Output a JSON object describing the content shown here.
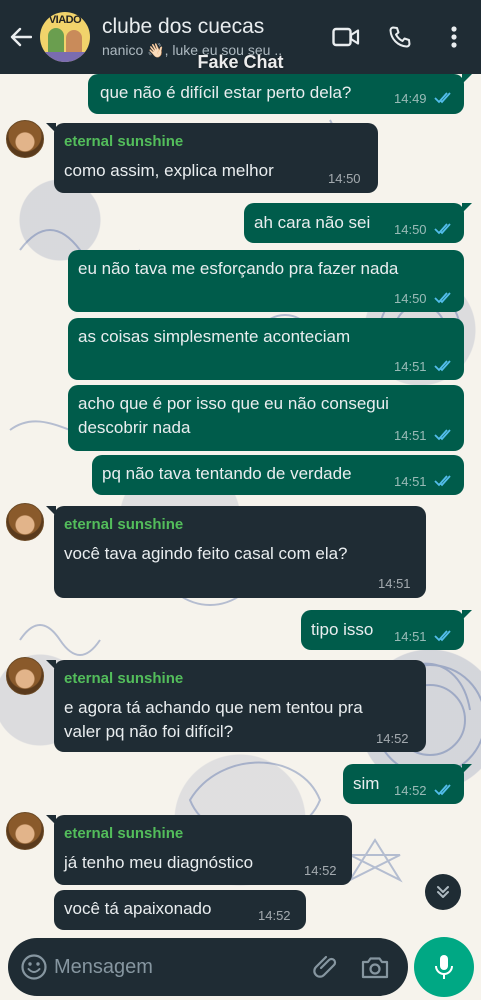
{
  "header": {
    "avatar_text": "VIADO",
    "title": "clube dos cuecas",
    "members": "nanico 👋🏻, luke eu sou seu .."
  },
  "watermark": "Fake Chat",
  "colors": {
    "header_bg": "#1f2c34",
    "outgoing_bubble": "#005c4b",
    "incoming_bubble": "#1f2c34",
    "sender_name": "#53bd5b",
    "read_ticks": "#53bdeb",
    "mic_button": "#00a884"
  },
  "icons": {
    "back": "arrow-left",
    "video": "video-camera",
    "call": "phone",
    "menu": "vertical-dots",
    "emoji": "smiley",
    "attach": "paperclip",
    "camera": "camera",
    "mic": "microphone",
    "scroll": "double-chevron-down"
  },
  "messages": [
    {
      "dir": "out",
      "text": "que não é difícil estar perto dela?",
      "time": "14:49",
      "read": true
    },
    {
      "dir": "in",
      "sender": "eternal sunshine",
      "text": "como assim, explica melhor",
      "time": "14:50"
    },
    {
      "dir": "out",
      "text": "ah cara não sei",
      "time": "14:50",
      "read": true
    },
    {
      "dir": "out",
      "text": "eu não tava me esforçando pra fazer nada",
      "time": "14:50",
      "read": true
    },
    {
      "dir": "out",
      "text": "as coisas simplesmente aconteciam",
      "time": "14:51",
      "read": true
    },
    {
      "dir": "out",
      "text1": "acho que é por isso que eu não consegui",
      "text2": "descobrir nada",
      "time": "14:51",
      "read": true
    },
    {
      "dir": "out",
      "text": "pq não tava tentando de verdade",
      "time": "14:51",
      "read": true
    },
    {
      "dir": "in",
      "sender": "eternal sunshine",
      "text": "você tava agindo feito casal com ela?",
      "time": "14:51"
    },
    {
      "dir": "out",
      "text": "tipo isso",
      "time": "14:51",
      "read": true
    },
    {
      "dir": "in",
      "sender": "eternal sunshine",
      "text1": "e agora tá achando que nem tentou pra",
      "text2": "valer pq não foi difícil?",
      "time": "14:52"
    },
    {
      "dir": "out",
      "text": "sim",
      "time": "14:52",
      "read": true
    },
    {
      "dir": "in",
      "sender": "eternal sunshine",
      "text": "já tenho meu diagnóstico",
      "time": "14:52"
    },
    {
      "dir": "in",
      "text": "você tá apaixonado",
      "time": "14:52"
    }
  ],
  "composer": {
    "placeholder": "Mensagem"
  }
}
